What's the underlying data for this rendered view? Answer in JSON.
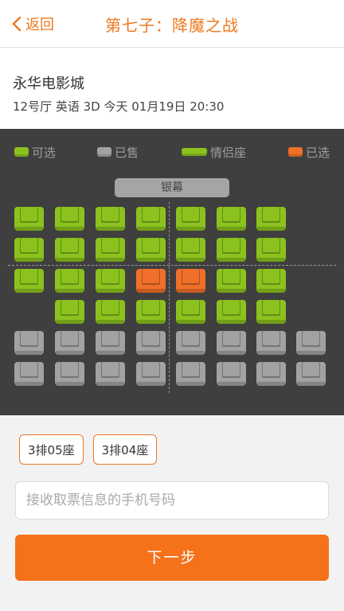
{
  "header": {
    "back_label": "返回",
    "title": "第七子：降魔之战"
  },
  "cinema": {
    "name": "永华电影城",
    "info": "12号厅 英语 3D 今天 01月19日 20:30"
  },
  "legend": [
    {
      "label": "可选",
      "status": "available"
    },
    {
      "label": "已售",
      "status": "sold"
    },
    {
      "label": "情侣座",
      "status": "couple"
    },
    {
      "label": "已选",
      "status": "selected"
    }
  ],
  "screen_label": "银幕",
  "colors": {
    "accent": "#f5721b",
    "available": "#8cc21e",
    "sold": "#a2a2a2",
    "selected": "#f0702a",
    "couple": "#8cc21e"
  },
  "seat_rows": [
    [
      "available",
      "available",
      "available",
      "available",
      "available",
      "available",
      "available",
      "empty"
    ],
    [
      "available",
      "available",
      "available",
      "available",
      "available",
      "available",
      "available",
      "empty"
    ],
    [
      "available",
      "available",
      "available",
      "selected",
      "selected",
      "available",
      "available",
      "empty"
    ],
    [
      "empty",
      "available",
      "available",
      "available",
      "available",
      "available",
      "available",
      "empty"
    ],
    [
      "sold",
      "sold",
      "sold",
      "sold",
      "sold",
      "sold",
      "sold",
      "sold"
    ],
    [
      "sold",
      "sold",
      "sold",
      "sold",
      "sold",
      "sold",
      "sold",
      "sold"
    ]
  ],
  "selected_chips": [
    "3排05座",
    "3排04座"
  ],
  "phone": {
    "value": "",
    "placeholder": "接收取票信息的手机号码"
  },
  "next_label": "下一步"
}
